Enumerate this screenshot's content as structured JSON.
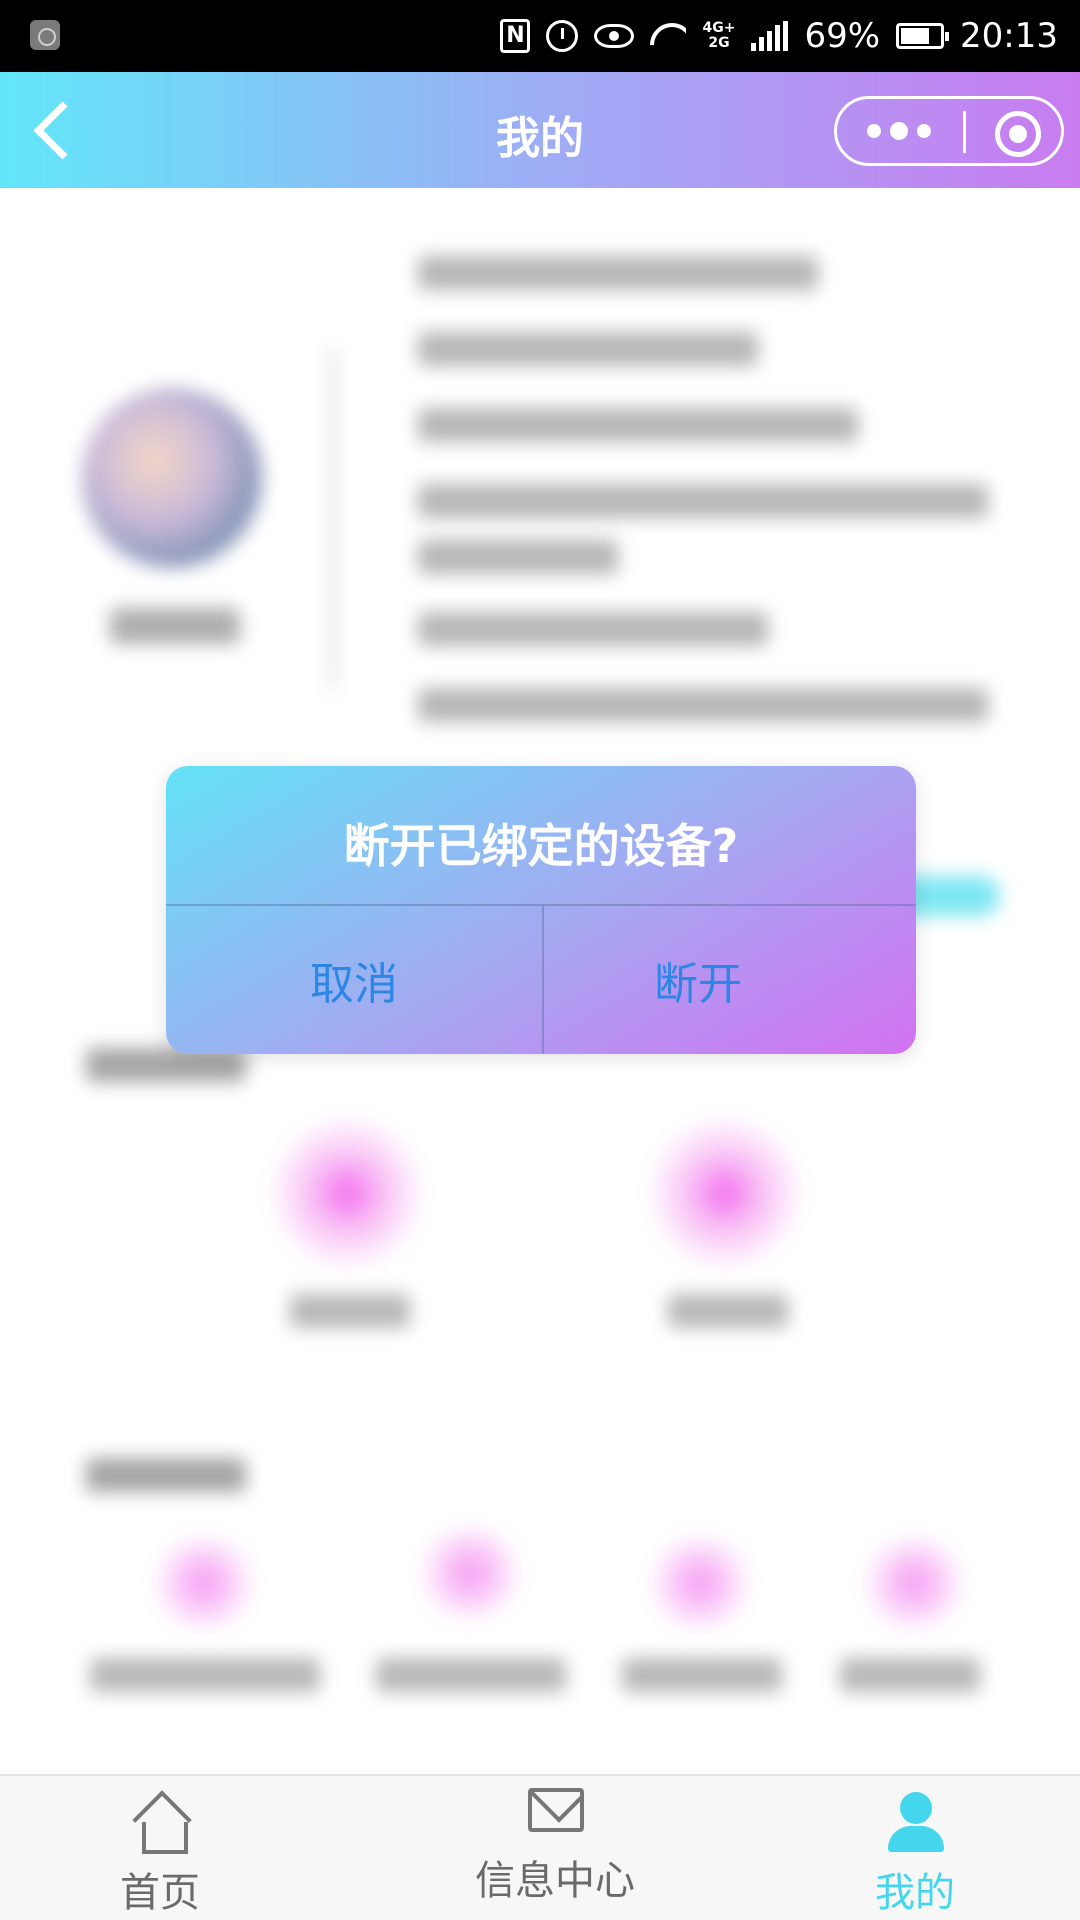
{
  "status_bar": {
    "battery": "69%",
    "time": "20:13",
    "network_top": "4G+",
    "network_bottom": "2G"
  },
  "header": {
    "title": "我的"
  },
  "dialog": {
    "title": "断开已绑定的设备?",
    "cancel_label": "取消",
    "confirm_label": "断开"
  },
  "tabbar": {
    "items": [
      {
        "label": "首页",
        "icon": "home-icon"
      },
      {
        "label": "信息中心",
        "icon": "mail-icon"
      },
      {
        "label": "我的",
        "icon": "user-icon"
      }
    ],
    "active_color": "#43d6ec"
  },
  "colors": {
    "header_gradient_start": "#62e6f8",
    "header_gradient_end": "#c97cf0",
    "dialog_button_text": "#2c86e3"
  }
}
